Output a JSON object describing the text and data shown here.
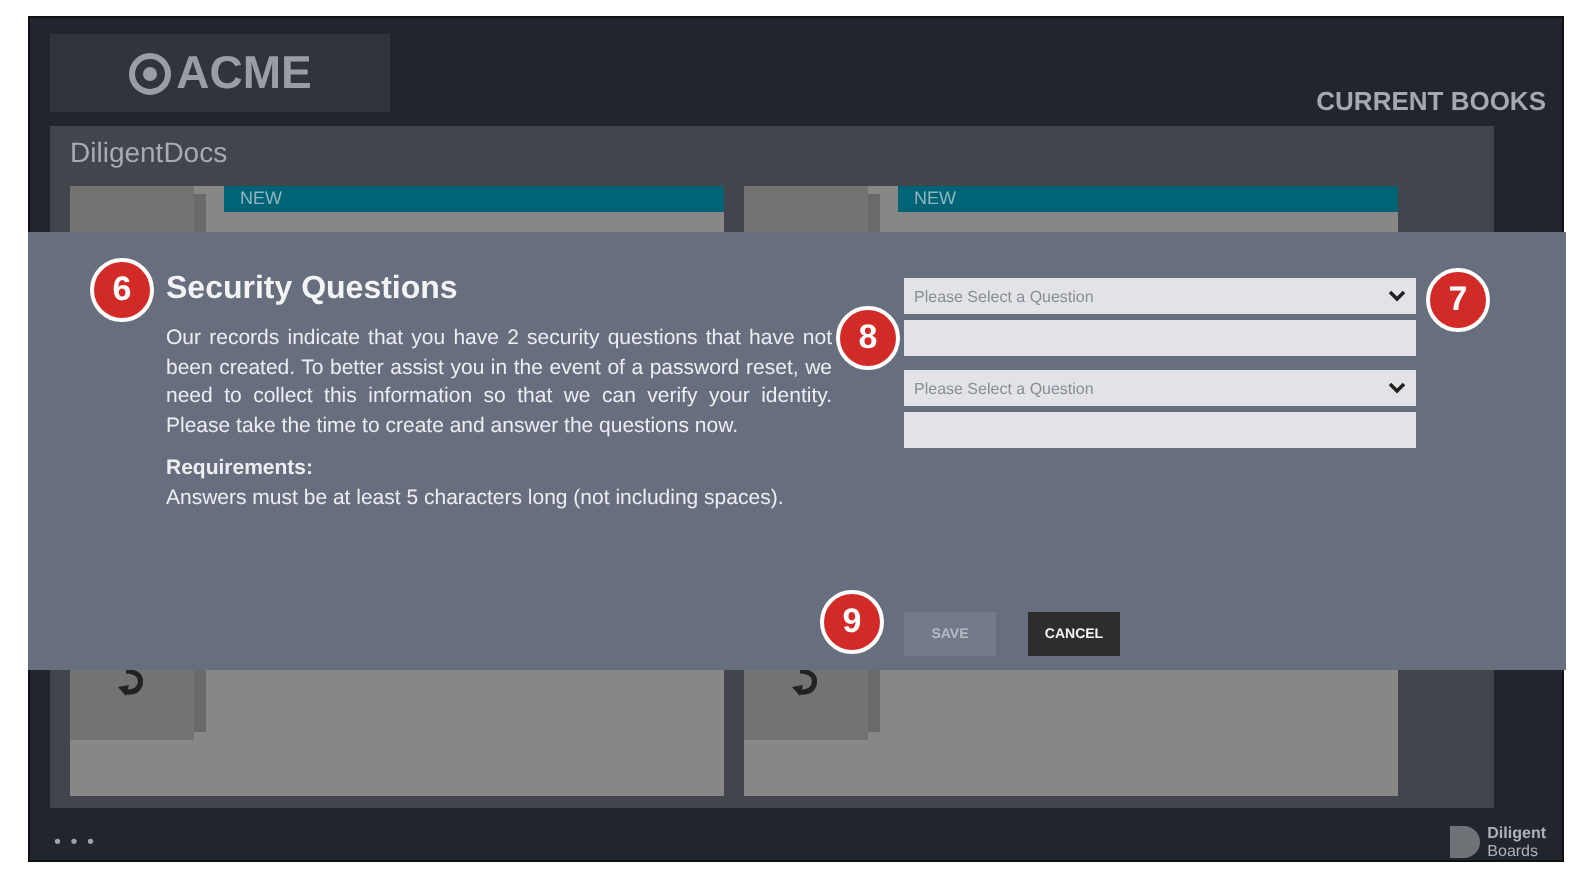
{
  "header": {
    "logo": "ACME",
    "section": "CURRENT BOOKS"
  },
  "library": {
    "title": "DiligentDocs",
    "books": [
      {
        "badge": "NEW"
      },
      {
        "badge": "NEW"
      }
    ]
  },
  "dialog": {
    "title": "Security Questions",
    "message": "Our records indicate that you have 2 security questions that have not been created. To better assist you in the event of a password reset, we need to collect this information so that we can verify your identity. Please take the time to create and answer the questions now.",
    "requirements_heading": "Requirements:",
    "requirements": "Answers must be at least 5 characters long (not including spaces).",
    "questions": [
      {
        "placeholder": "Please Select a Question"
      },
      {
        "placeholder": "Please Select a Question"
      }
    ],
    "buttons": [
      {
        "label": "SAVE",
        "disabled": true
      },
      {
        "label": "CANCEL",
        "disabled": false
      }
    ]
  },
  "callouts": [
    "6",
    "8",
    "7",
    "9"
  ],
  "footer": {
    "more": "• • •",
    "brand": [
      "Diligent",
      "Boards"
    ]
  }
}
